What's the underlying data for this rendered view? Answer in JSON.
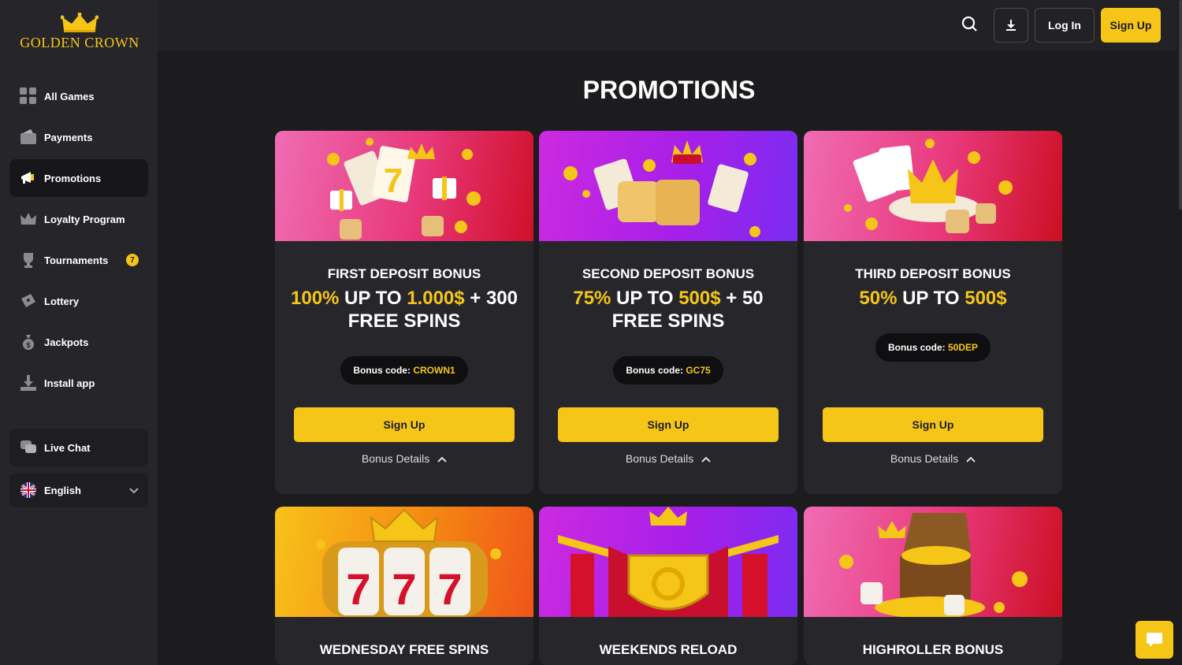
{
  "brand": {
    "name": "GOLDEN CROWN"
  },
  "sidebar": {
    "items": [
      {
        "label": "All Games",
        "icon": "grid-icon"
      },
      {
        "label": "Payments",
        "icon": "wallet-icon"
      },
      {
        "label": "Promotions",
        "icon": "megaphone-icon",
        "active": true
      },
      {
        "label": "Loyalty Program",
        "icon": "crown-icon"
      },
      {
        "label": "Tournaments",
        "icon": "trophy-icon",
        "badge": "7"
      },
      {
        "label": "Lottery",
        "icon": "ticket-icon"
      },
      {
        "label": "Jackpots",
        "icon": "money-bag-icon"
      },
      {
        "label": "Install app",
        "icon": "download-icon"
      }
    ],
    "live_chat": "Live Chat",
    "language": "English"
  },
  "topbar": {
    "login": "Log In",
    "signup": "Sign Up"
  },
  "page": {
    "title": "PROMOTIONS"
  },
  "promos": [
    {
      "title": "FIRST DEPOSIT BONUS",
      "offer_a": "100%",
      "offer_b": " UP TO ",
      "offer_c": "1.000$",
      "offer_d": " + 300 FREE SPINS",
      "code_label": "Bonus code: ",
      "code": "CROWN1",
      "button": "Sign Up",
      "details": "Bonus Details"
    },
    {
      "title": "SECOND DEPOSIT BONUS",
      "offer_a": "75%",
      "offer_b": " UP TO ",
      "offer_c": "500$",
      "offer_d": " + 50 FREE SPINS",
      "code_label": "Bonus code: ",
      "code": "GC75",
      "button": "Sign Up",
      "details": "Bonus Details"
    },
    {
      "title": "THIRD DEPOSIT BONUS",
      "offer_a": "50%",
      "offer_b": " UP TO ",
      "offer_c": "500$",
      "offer_d": "",
      "code_label": "Bonus code: ",
      "code": "50DEP",
      "button": "Sign Up",
      "details": "Bonus Details"
    },
    {
      "title": "WEDNESDAY FREE SPINS"
    },
    {
      "title": "WEEKENDS RELOAD"
    },
    {
      "title": "HIGHROLLER BONUS"
    }
  ],
  "colors": {
    "accent": "#f5c518",
    "background": "#1c1c1f",
    "sidebar": "#26262a",
    "card": "#27272b"
  }
}
